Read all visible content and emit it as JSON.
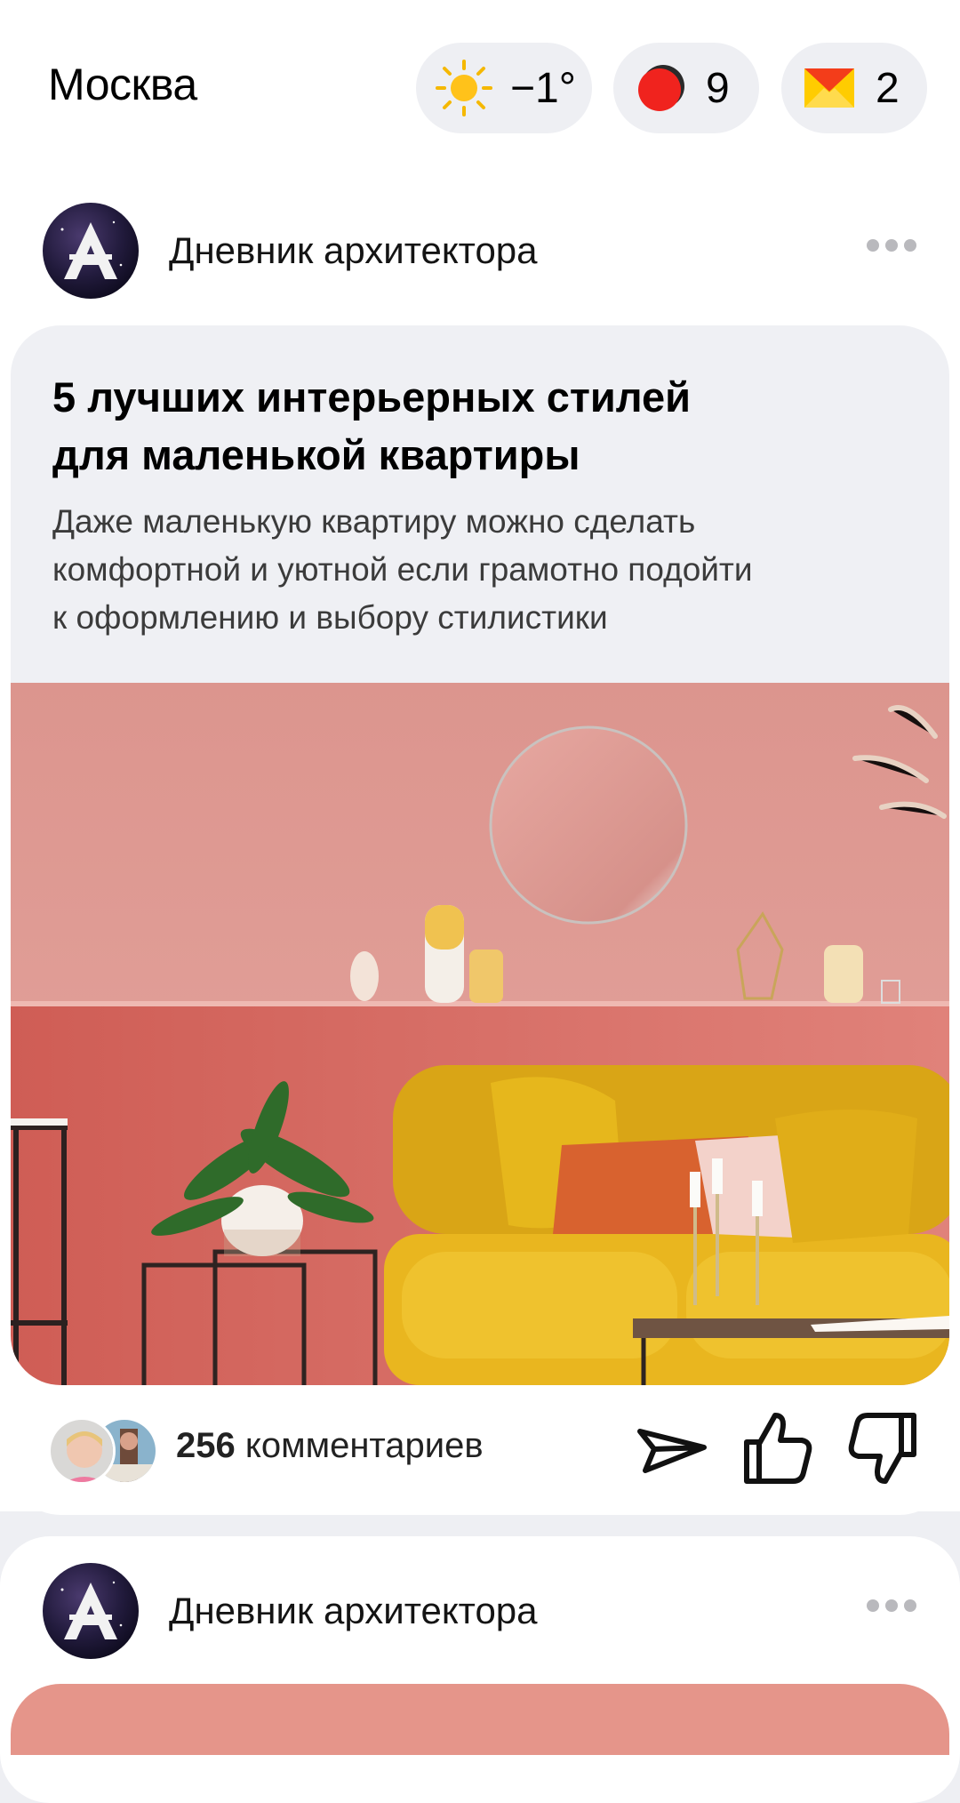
{
  "header": {
    "city": "Москва",
    "weather": {
      "icon": "sun-icon",
      "temp": "−1°"
    },
    "traffic": {
      "icon": "traffic-icon",
      "score": "9"
    },
    "mail": {
      "icon": "mail-icon",
      "count": "2"
    }
  },
  "posts": [
    {
      "channel": "Дневник архитектора",
      "title": "5 лучших интерьерных стилей\nдля маленькой квартиры",
      "subtitle": "Даже маленькую квартиру можно сделать\nкомфортной и уютной если грамотно подойти\nк оформлению и выбору стилистики",
      "image": "pink-living-room-yellow-sofa",
      "comments_count": "256",
      "comments_label": "комментариев",
      "actions": [
        "share-icon",
        "like-icon",
        "dislike-icon"
      ]
    },
    {
      "channel": "Дневник архитектора"
    }
  ],
  "colors": {
    "background": "#eeeff3",
    "card_text_bg": "#eff0f4",
    "pill_bg": "#eeeff3",
    "wall_pink": "#e39b95",
    "sofa_yellow": "#e7b81f"
  }
}
